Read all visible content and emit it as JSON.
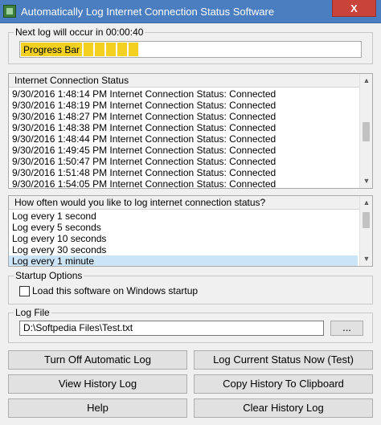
{
  "window": {
    "title": "Automatically Log Internet Connection Status Software",
    "close_glyph": "X"
  },
  "next_log": {
    "label": "Next log will occur in 00:00:40",
    "progress_label": "Progress Bar",
    "progress_fraction": 0.35
  },
  "status_list": {
    "header": "Internet Connection Status",
    "lines": [
      "9/30/2016 1:48:14 PM Internet Connection Status: Connected",
      "9/30/2016 1:48:19 PM Internet Connection Status: Connected",
      "9/30/2016 1:48:27 PM Internet Connection Status: Connected",
      "9/30/2016 1:48:38 PM Internet Connection Status: Connected",
      "9/30/2016 1:48:44 PM Internet Connection Status: Connected",
      "9/30/2016 1:49:45 PM Internet Connection Status: Connected",
      "9/30/2016 1:50:47 PM Internet Connection Status: Connected",
      "9/30/2016 1:51:48 PM Internet Connection Status: Connected",
      "9/30/2016 1:54:05 PM Internet Connection Status: Connected"
    ]
  },
  "frequency_list": {
    "header": "How often would you like to log internet connection status?",
    "options": [
      "Log every 1 second",
      "Log every 5 seconds",
      "Log every 10 seconds",
      "Log every 30 seconds",
      "Log every 1 minute"
    ],
    "selected_index": 4
  },
  "startup": {
    "group_label": "Startup Options",
    "checkbox_label": "Load this software on Windows startup",
    "checked": false
  },
  "log_file": {
    "group_label": "Log File",
    "path": "D:\\Softpedia Files\\Test.txt",
    "browse_label": "..."
  },
  "buttons": {
    "turn_off": "Turn Off Automatic Log",
    "log_now": "Log Current Status Now (Test)",
    "view_history": "View History Log",
    "copy_history": "Copy History To Clipboard",
    "help": "Help",
    "clear_history": "Clear History Log"
  },
  "icons": {
    "app": "app-network-icon",
    "scroll_up": "scroll-up-arrow-icon",
    "scroll_down": "scroll-down-arrow-icon"
  }
}
